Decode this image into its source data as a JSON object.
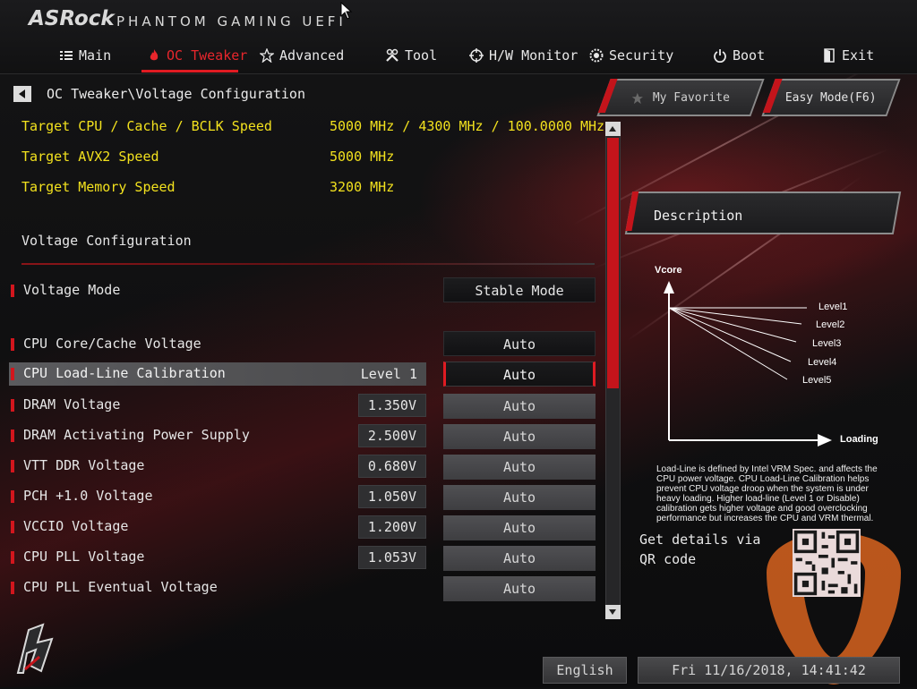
{
  "header": {
    "brand": "ASRock",
    "product": "PHANTOM GAMING UEFI"
  },
  "nav": [
    {
      "label": "Main",
      "icon": "list-icon"
    },
    {
      "label": "OC Tweaker",
      "icon": "flame-icon",
      "active": true
    },
    {
      "label": "Advanced",
      "icon": "star-icon"
    },
    {
      "label": "Tool",
      "icon": "wrench-icon"
    },
    {
      "label": "H/W Monitor",
      "icon": "crosshair-icon"
    },
    {
      "label": "Security",
      "icon": "shield-gear-icon"
    },
    {
      "label": "Boot",
      "icon": "power-icon"
    },
    {
      "label": "Exit",
      "icon": "exit-door-icon"
    }
  ],
  "breadcrumb": "OC Tweaker\\Voltage Configuration",
  "buttons": {
    "favorite": "My Favorite",
    "easy_mode": "Easy Mode(F6)"
  },
  "targets": [
    {
      "label": "Target CPU / Cache / BCLK Speed",
      "value": "5000 MHz / 4300 MHz / 100.0000 MHz"
    },
    {
      "label": "Target AVX2 Speed",
      "value": "5000 MHz"
    },
    {
      "label": "Target Memory Speed",
      "value": "3200 MHz"
    }
  ],
  "section_title": "Voltage Configuration",
  "settings": [
    {
      "label": "Voltage Mode",
      "current": "",
      "option": "Stable Mode"
    },
    {
      "label": "CPU Core/Cache Voltage",
      "current": "",
      "option": "Auto"
    },
    {
      "label": "CPU Load-Line Calibration",
      "current": "Level 1",
      "option": "Auto"
    },
    {
      "label": "DRAM Voltage",
      "current": "1.350V",
      "option": "Auto"
    },
    {
      "label": "DRAM Activating Power Supply",
      "current": "2.500V",
      "option": "Auto"
    },
    {
      "label": "VTT DDR Voltage",
      "current": "0.680V",
      "option": "Auto"
    },
    {
      "label": "PCH +1.0 Voltage",
      "current": "1.050V",
      "option": "Auto"
    },
    {
      "label": "VCCIO Voltage",
      "current": "1.200V",
      "option": "Auto"
    },
    {
      "label": "CPU PLL Voltage",
      "current": "1.053V",
      "option": "Auto"
    },
    {
      "label": "CPU PLL Eventual Voltage",
      "current": "",
      "option": "Auto"
    }
  ],
  "description": {
    "title": "Description",
    "diagram": {
      "y_label": "Vcore",
      "x_label": "Loading",
      "levels": [
        "Level1",
        "Level2",
        "Level3",
        "Level4",
        "Level5"
      ]
    },
    "text": "Load-Line is defined by Intel VRM Spec. and affects the CPU power voltage. CPU Load-Line Calibration helps prevent CPU voltage droop when the system is under heavy loading. Higher load-line (Level 1 or Disable) calibration gets higher voltage and good overclocking performance but increases the CPU and VRM thermal.",
    "qr_label": "Get details via QR code"
  },
  "footer": {
    "language": "English",
    "datetime": "Fri 11/16/2018, 14:41:42"
  },
  "colors": {
    "accent_red": "#e01b22",
    "target_yellow": "#f2e11e"
  }
}
